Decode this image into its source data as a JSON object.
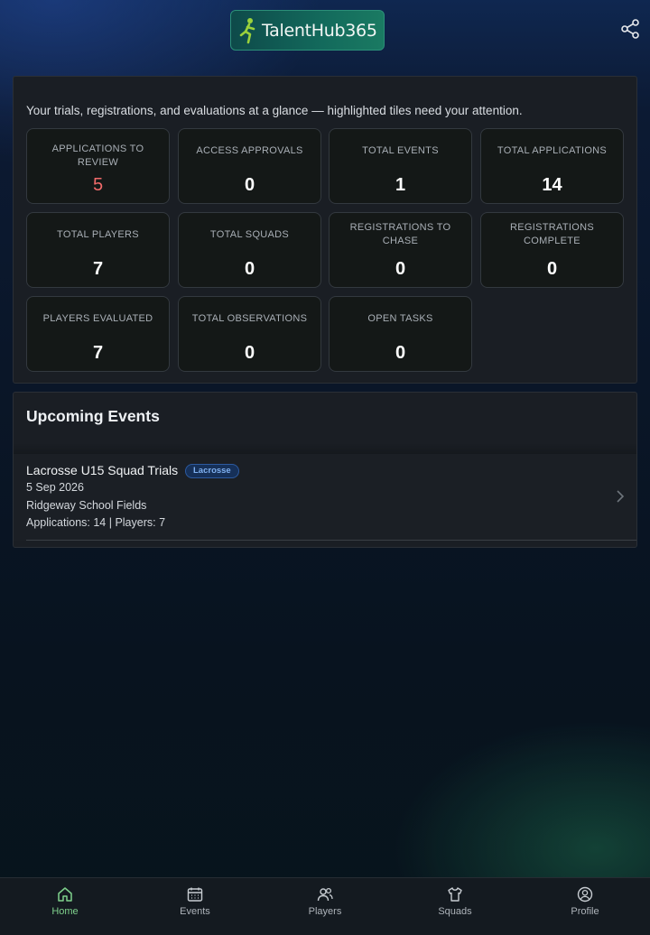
{
  "app": {
    "brand_name": "TalentHub365",
    "accent_color": "#7fd18c",
    "alert_color": "#f06a6a"
  },
  "summary": {
    "intro": "Your trials, registrations, and evaluations at a glance — highlighted tiles need your attention.",
    "tiles": [
      {
        "label": "APPLICATIONS TO REVIEW",
        "value": "5",
        "highlighted": true
      },
      {
        "label": "ACCESS APPROVALS",
        "value": "0",
        "highlighted": false
      },
      {
        "label": "TOTAL EVENTS",
        "value": "1",
        "highlighted": false
      },
      {
        "label": "TOTAL APPLICATIONS",
        "value": "14",
        "highlighted": false
      },
      {
        "label": "TOTAL PLAYERS",
        "value": "7",
        "highlighted": false
      },
      {
        "label": "TOTAL SQUADS",
        "value": "0",
        "highlighted": false
      },
      {
        "label": "REGISTRATIONS TO CHASE",
        "value": "0",
        "highlighted": false
      },
      {
        "label": "REGISTRATIONS COMPLETE",
        "value": "0",
        "highlighted": false
      },
      {
        "label": "PLAYERS EVALUATED",
        "value": "7",
        "highlighted": false
      },
      {
        "label": "TOTAL OBSERVATIONS",
        "value": "0",
        "highlighted": false
      },
      {
        "label": "OPEN TASKS",
        "value": "0",
        "highlighted": false
      }
    ]
  },
  "upcoming_events": {
    "title": "Upcoming Events",
    "items": [
      {
        "name": "Lacrosse U15 Squad Trials",
        "sport_badge": "Lacrosse",
        "date": "5 Sep 2026",
        "venue": "Ridgeway School Fields",
        "stats": "Applications: 14 | Players: 7"
      }
    ]
  },
  "bottom_nav": {
    "items": [
      {
        "label": "Home",
        "icon": "home-icon",
        "active": true
      },
      {
        "label": "Events",
        "icon": "calendar-icon",
        "active": false
      },
      {
        "label": "Players",
        "icon": "users-icon",
        "active": false
      },
      {
        "label": "Squads",
        "icon": "shirt-icon",
        "active": false
      },
      {
        "label": "Profile",
        "icon": "user-circle-icon",
        "active": false
      }
    ]
  },
  "icons": {
    "share": "share-icon",
    "chevron": "chevron-right-icon"
  }
}
